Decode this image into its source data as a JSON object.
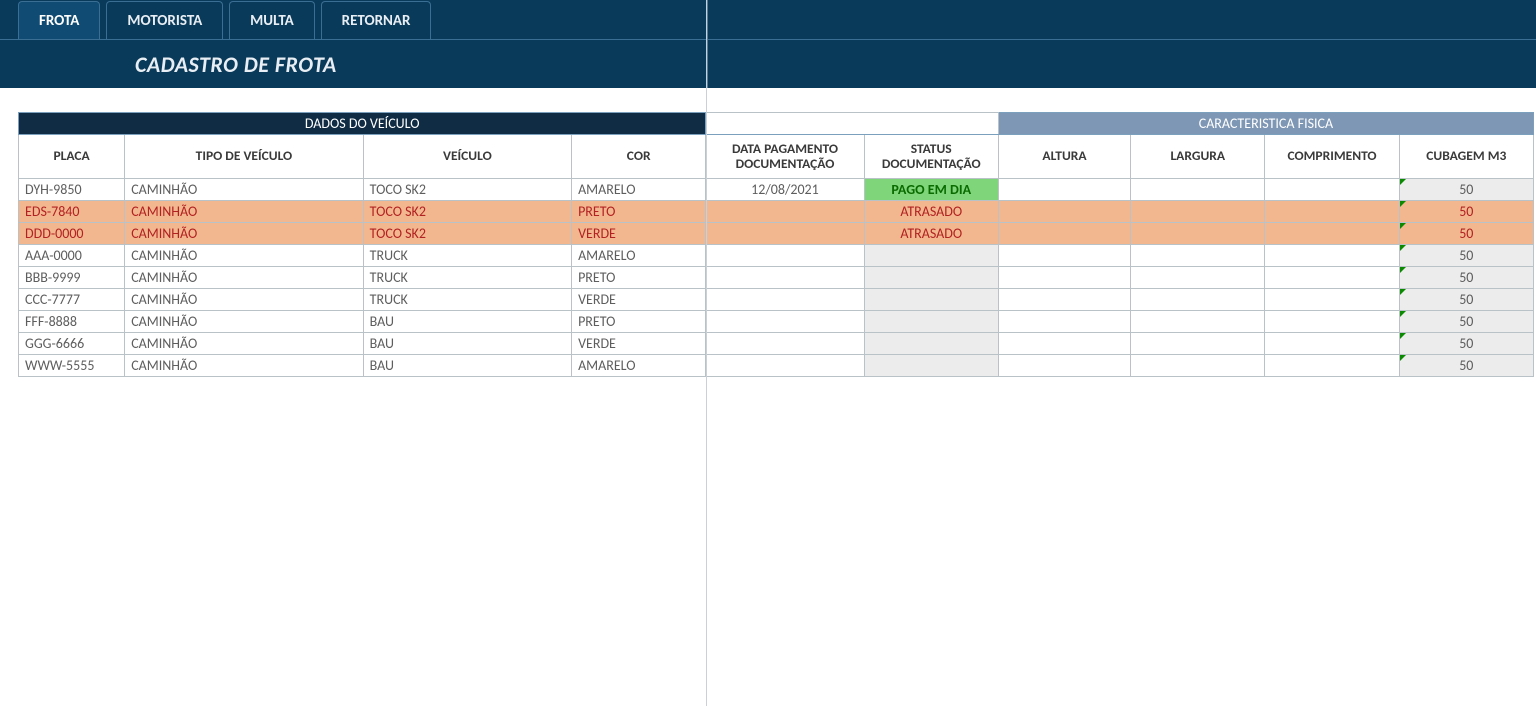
{
  "tabs": [
    {
      "label": "FROTA",
      "active": true
    },
    {
      "label": "MOTORISTA",
      "active": false
    },
    {
      "label": "MULTA",
      "active": false
    },
    {
      "label": "RETORNAR",
      "active": false
    }
  ],
  "subtitle": "CADASTRO DE FROTA",
  "groups": {
    "vehicle": "DADOS DO VEÍCULO",
    "physical": "CARACTERISTICA FISICA"
  },
  "columns": {
    "placa": "PLACA",
    "tipo": "TIPO DE VEÍCULO",
    "veic": "VEÍCULO",
    "cor": "COR",
    "data": "DATA PAGAMENTO DOCUMENTAÇÃO",
    "status": "STATUS DOCUMENTAÇÃO",
    "altura": "ALTURA",
    "largura": "LARGURA",
    "compr": "COMPRIMENTO",
    "cubag": "CUBAGEM M3"
  },
  "status_labels": {
    "paid": "PAGO EM DIA",
    "late": "ATRASADO"
  },
  "rows": [
    {
      "placa": "DYH-9850",
      "tipo": "CAMINHÃO",
      "veic": "TOCO SK2",
      "cor": "AMARELO",
      "data": "12/08/2021",
      "status": "paid",
      "altura": "",
      "largura": "",
      "compr": "",
      "cubag": "50",
      "late": false
    },
    {
      "placa": "EDS-7840",
      "tipo": "CAMINHÃO",
      "veic": "TOCO SK2",
      "cor": "PRETO",
      "data": "",
      "status": "late",
      "altura": "",
      "largura": "",
      "compr": "",
      "cubag": "50",
      "late": true
    },
    {
      "placa": "DDD-0000",
      "tipo": "CAMINHÃO",
      "veic": "TOCO SK2",
      "cor": "VERDE",
      "data": "",
      "status": "late",
      "altura": "",
      "largura": "",
      "compr": "",
      "cubag": "50",
      "late": true
    },
    {
      "placa": "AAA-0000",
      "tipo": "CAMINHÃO",
      "veic": "TRUCK",
      "cor": "AMARELO",
      "data": "",
      "status": "",
      "altura": "",
      "largura": "",
      "compr": "",
      "cubag": "50",
      "late": false
    },
    {
      "placa": "BBB-9999",
      "tipo": "CAMINHÃO",
      "veic": "TRUCK",
      "cor": "PRETO",
      "data": "",
      "status": "",
      "altura": "",
      "largura": "",
      "compr": "",
      "cubag": "50",
      "late": false
    },
    {
      "placa": "CCC-7777",
      "tipo": "CAMINHÃO",
      "veic": "TRUCK",
      "cor": "VERDE",
      "data": "",
      "status": "",
      "altura": "",
      "largura": "",
      "compr": "",
      "cubag": "50",
      "late": false
    },
    {
      "placa": "FFF-8888",
      "tipo": "CAMINHÃO",
      "veic": "BAU",
      "cor": "PRETO",
      "data": "",
      "status": "",
      "altura": "",
      "largura": "",
      "compr": "",
      "cubag": "50",
      "late": false
    },
    {
      "placa": "GGG-6666",
      "tipo": "CAMINHÃO",
      "veic": "BAU",
      "cor": "VERDE",
      "data": "",
      "status": "",
      "altura": "",
      "largura": "",
      "compr": "",
      "cubag": "50",
      "late": false
    },
    {
      "placa": "WWW-5555",
      "tipo": "CAMINHÃO",
      "veic": "BAU",
      "cor": "AMARELO",
      "data": "",
      "status": "",
      "altura": "",
      "largura": "",
      "compr": "",
      "cubag": "50",
      "late": false
    }
  ]
}
